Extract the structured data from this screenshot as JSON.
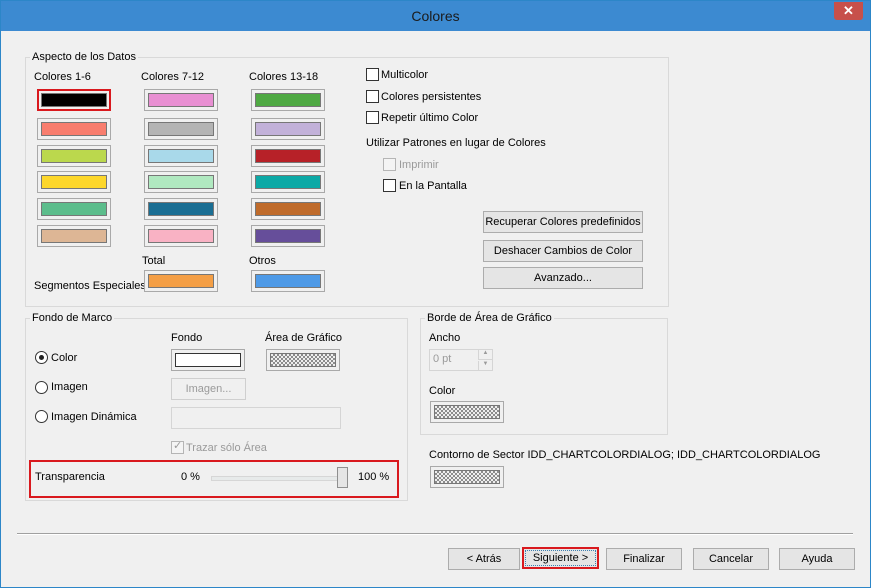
{
  "window": {
    "title": "Colores",
    "close_label": "✕"
  },
  "data_group": {
    "label": "Aspecto de los Datos",
    "col_labels": [
      "Colores 1-6",
      "Colores 7-12",
      "Colores 13-18"
    ],
    "colors_1_6": [
      "#000000",
      "#f87d6e",
      "#bbd84d",
      "#fdd72b",
      "#5cbd8c",
      "#ddb695"
    ],
    "colors_7_12": [
      "#e88fd2",
      "#b4b4b4",
      "#a9d9ea",
      "#b0e9c0",
      "#1a6e93",
      "#f9b2c4"
    ],
    "colors_13_18": [
      "#4fa943",
      "#c2b1d9",
      "#b72128",
      "#0ca9a6",
      "#bf6b2b",
      "#664e9a"
    ],
    "total_label": "Total",
    "total_color": "#f49f46",
    "otros_label": "Otros",
    "otros_color": "#4e9ae7",
    "special_label": "Segmentos Especiales",
    "multicolor_label": "Multicolor",
    "persistent_label": "Colores persistentes",
    "repeat_label": "Repetir último Color",
    "patterns_label": "Utilizar Patrones en lugar de Colores",
    "print_label": "Imprimir",
    "screen_label": "En la Pantalla",
    "restore_button": "Recuperar Colores predefinidos",
    "undo_button": "Deshacer Cambios de Color",
    "advanced_button": "Avanzado..."
  },
  "frame_group": {
    "label": "Fondo de Marco",
    "fondo_label": "Fondo",
    "area_label": "Área de Gráfico",
    "color_label": "Color",
    "image_label": "Imagen",
    "image_button": "Imagen...",
    "dynamic_label": "Imagen Dinámica",
    "trace_label": "Trazar sólo Área",
    "transparency_label": "Transparencia",
    "min_label": "0 %",
    "max_label": "100 %",
    "transparency_value": 1.0
  },
  "border_group": {
    "label": "Borde de Área de Gráfico",
    "width_label": "Ancho",
    "width_value": "0 pt",
    "color_label": "Color"
  },
  "contour_label": "Contorno de Sector IDD_CHARTCOLORDIALOG; IDD_CHARTCOLORDIALOG",
  "footer": {
    "back": "< Atrás",
    "next": "Siguiente >",
    "finish": "Finalizar",
    "cancel": "Cancelar",
    "help": "Ayuda"
  }
}
